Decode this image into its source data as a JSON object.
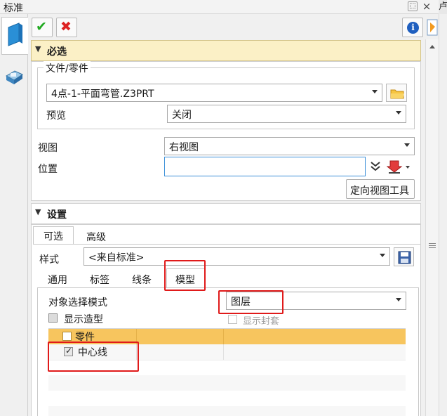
{
  "window": {
    "title": "标准",
    "pin_glyph": "⬚",
    "close_glyph": "×",
    "edge_glyph": "卢"
  },
  "toolbar": {
    "ok_label": "✔",
    "cancel_label": "✖",
    "info_label": "i"
  },
  "colors": {
    "section_header": "#fbf0c6",
    "accent_ok": "#22aa22",
    "accent_cancel": "#dd2222",
    "highlight": "#e01a1a",
    "selected_row": "#f7c55e"
  },
  "required": {
    "header": "必选",
    "file_group_label": "文件/零件",
    "file_value": "4点-1-平面弯管.Z3PRT",
    "preview_label": "预览",
    "preview_value": "关闭",
    "view_label": "视图",
    "view_value": "右视图",
    "position_label": "位置",
    "position_value": "",
    "orient_tool_button": "定向视图工具"
  },
  "settings": {
    "header": "设置",
    "tabs": [
      "可选",
      "高级"
    ],
    "style_label": "样式",
    "style_value": "<来自标准>",
    "subtabs": [
      "通用",
      "标签",
      "线条",
      "模型"
    ],
    "select_mode_label": "对象选择模式",
    "select_mode_value": "图层",
    "show_shape_label": "显示造型",
    "show_assembly_label": "显示封套",
    "rows": [
      {
        "label": "零件",
        "checked": false
      },
      {
        "label": "中心线",
        "checked": true
      }
    ]
  }
}
